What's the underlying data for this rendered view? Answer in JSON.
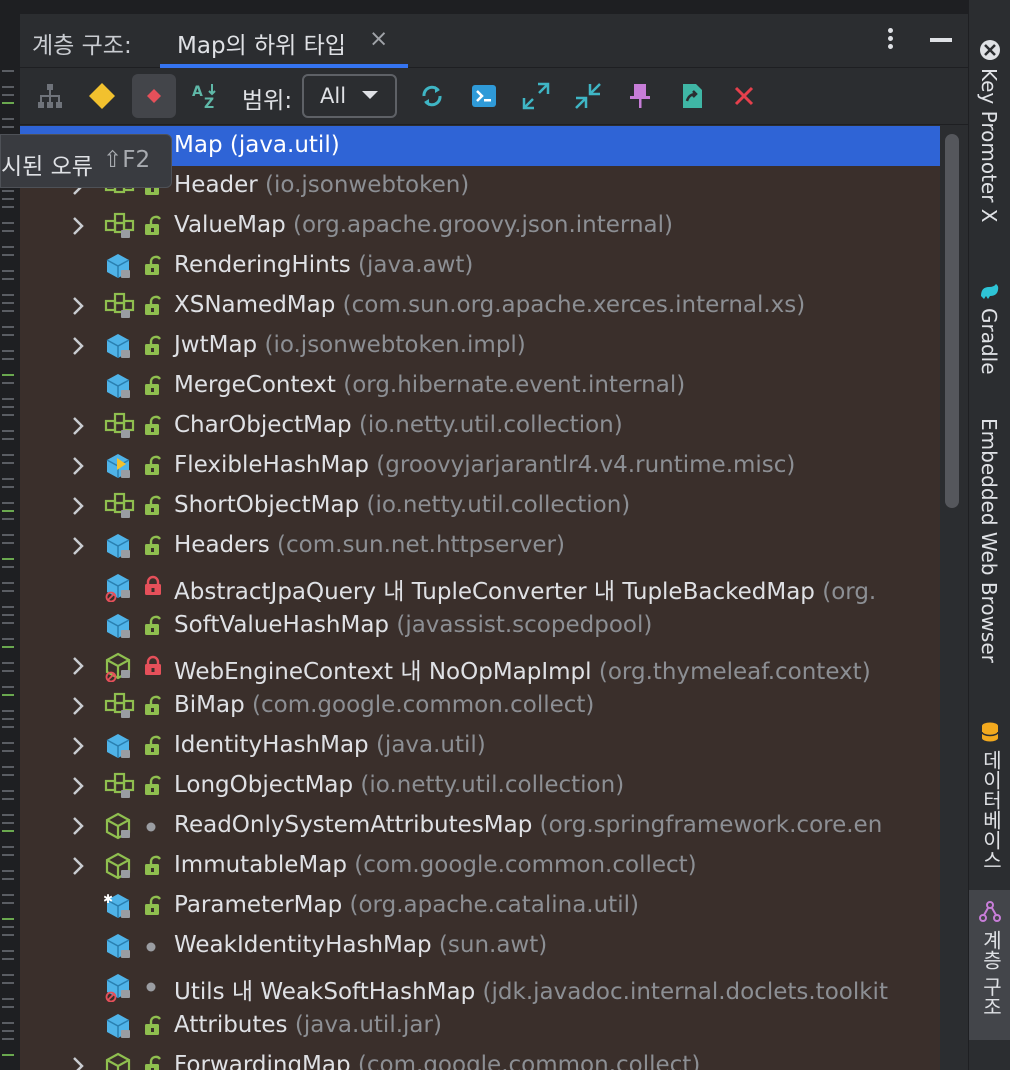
{
  "header": {
    "tool_title": "계층 구조:",
    "tab_label": "Map의 하위 타입",
    "tab_close": "×"
  },
  "toolbar": {
    "scope_label": "범위:",
    "scope_value": "All",
    "buttons": [
      "hierarchy-icon",
      "supertypes-icon",
      "subtypes-icon",
      "sort-alpha-icon",
      "refresh-icon",
      "terminal-icon",
      "expand-icon",
      "collapse-icon",
      "pin-icon",
      "export-icon",
      "close-icon"
    ]
  },
  "tooltip": {
    "text": "시된 오류",
    "shortcut": "⇧F2"
  },
  "tree": {
    "rows": [
      {
        "name": "Map",
        "pkg": "(java.util)",
        "expandable": false,
        "icon": "interface",
        "vis": "none",
        "selected": true
      },
      {
        "name": "Header",
        "pkg": "(io.jsonwebtoken)",
        "expandable": true,
        "icon": "interface",
        "vis": "public"
      },
      {
        "name": "ValueMap",
        "pkg": "(org.apache.groovy.json.internal)",
        "expandable": true,
        "icon": "interface-lock",
        "vis": "public"
      },
      {
        "name": "RenderingHints",
        "pkg": "(java.awt)",
        "expandable": false,
        "icon": "class",
        "vis": "public"
      },
      {
        "name": "XSNamedMap",
        "pkg": "(com.sun.org.apache.xerces.internal.xs)",
        "expandable": true,
        "icon": "interface-lock",
        "vis": "public"
      },
      {
        "name": "JwtMap",
        "pkg": "(io.jsonwebtoken.impl)",
        "expandable": true,
        "icon": "class",
        "vis": "public"
      },
      {
        "name": "MergeContext",
        "pkg": "(org.hibernate.event.internal)",
        "expandable": false,
        "icon": "class",
        "vis": "public"
      },
      {
        "name": "CharObjectMap",
        "pkg": "(io.netty.util.collection)",
        "expandable": true,
        "icon": "interface-lock",
        "vis": "public"
      },
      {
        "name": "FlexibleHashMap",
        "pkg": "(groovyjarjarantlr4.v4.runtime.misc)",
        "expandable": true,
        "icon": "class-run",
        "vis": "public"
      },
      {
        "name": "ShortObjectMap",
        "pkg": "(io.netty.util.collection)",
        "expandable": true,
        "icon": "interface-lock",
        "vis": "public"
      },
      {
        "name": "Headers",
        "pkg": "(com.sun.net.httpserver)",
        "expandable": true,
        "icon": "class",
        "vis": "public"
      },
      {
        "name": "AbstractJpaQuery 내 TupleConverter 내 TupleBackedMap",
        "pkg": "(org.",
        "expandable": false,
        "icon": "class-error",
        "vis": "private"
      },
      {
        "name": "SoftValueHashMap",
        "pkg": "(javassist.scopedpool)",
        "expandable": false,
        "icon": "class",
        "vis": "public"
      },
      {
        "name": "WebEngineContext 내 NoOpMapImpl",
        "pkg": "(org.thymeleaf.context)",
        "expandable": true,
        "icon": "class-outline-error",
        "vis": "private"
      },
      {
        "name": "BiMap",
        "pkg": "(com.google.common.collect)",
        "expandable": true,
        "icon": "interface-lock",
        "vis": "public"
      },
      {
        "name": "IdentityHashMap",
        "pkg": "(java.util)",
        "expandable": true,
        "icon": "class",
        "vis": "public"
      },
      {
        "name": "LongObjectMap",
        "pkg": "(io.netty.util.collection)",
        "expandable": true,
        "icon": "interface-lock",
        "vis": "public"
      },
      {
        "name": "ReadOnlySystemAttributesMap",
        "pkg": "(org.springframework.core.en",
        "expandable": true,
        "icon": "class-outline",
        "vis": "package"
      },
      {
        "name": "ImmutableMap",
        "pkg": "(com.google.common.collect)",
        "expandable": true,
        "icon": "class-outline",
        "vis": "public"
      },
      {
        "name": "ParameterMap",
        "pkg": "(org.apache.catalina.util)",
        "expandable": false,
        "icon": "class-star",
        "vis": "public"
      },
      {
        "name": "WeakIdentityHashMap",
        "pkg": "(sun.awt)",
        "expandable": false,
        "icon": "class",
        "vis": "package"
      },
      {
        "name": "Utils 내 WeakSoftHashMap",
        "pkg": "(jdk.javadoc.internal.doclets.toolkit",
        "expandable": false,
        "icon": "class-error",
        "vis": "package"
      },
      {
        "name": "Attributes",
        "pkg": "(java.util.jar)",
        "expandable": false,
        "icon": "class",
        "vis": "public"
      },
      {
        "name": "ForwardingMap",
        "pkg": "(com.google.common.collect)",
        "expandable": true,
        "icon": "class-outline",
        "vis": "public"
      }
    ]
  },
  "right_stripe": [
    {
      "label": "Key Promoter X",
      "icon": "key-promoter-icon",
      "active": false
    },
    {
      "label": "Gradle",
      "icon": "gradle-icon",
      "active": false
    },
    {
      "label": "Embedded Web Browser",
      "icon": "",
      "active": false
    },
    {
      "label": "데이터베이스",
      "icon": "database-icon",
      "active": false
    },
    {
      "label": "계층 구조",
      "icon": "hierarchy-icon",
      "active": true
    }
  ],
  "colors": {
    "accent": "#3574f0",
    "selection": "#2f64d6",
    "tree_bg": "#3a2f2b",
    "interface_green": "#8fbf4f",
    "class_blue": "#4fb3e8",
    "lock_red": "#e5505a"
  }
}
